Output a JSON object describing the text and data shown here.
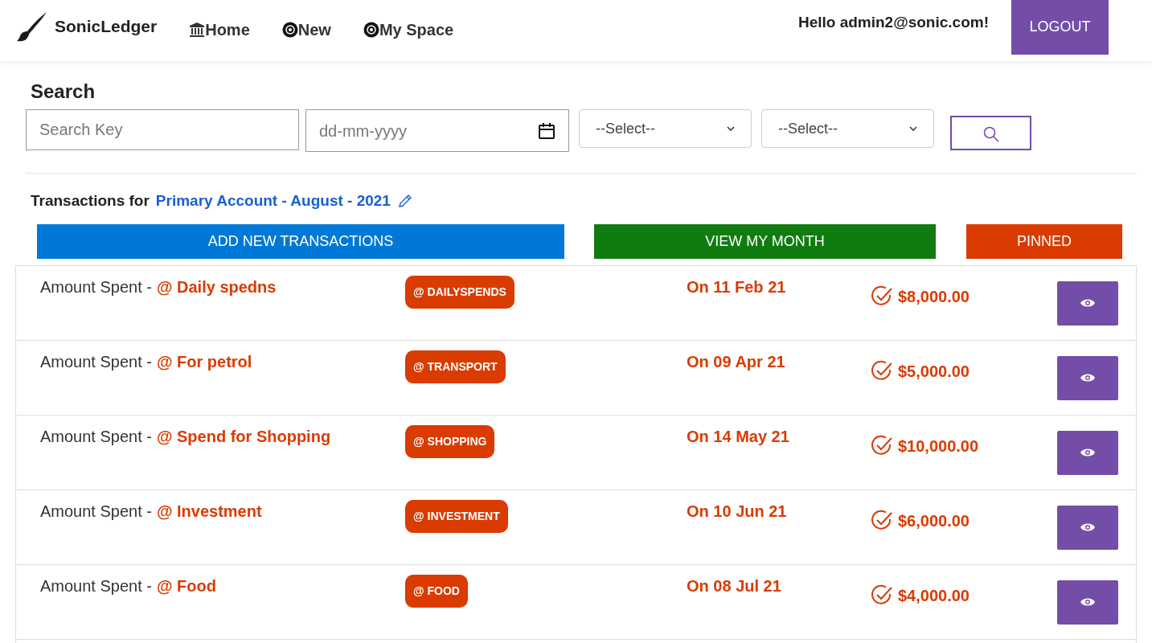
{
  "brand": "SonicLedger",
  "nav": [
    {
      "label": "Home"
    },
    {
      "label": "New"
    },
    {
      "label": "My Space"
    }
  ],
  "greeting": "Hello admin2@sonic.com!",
  "logout": "LOGOUT",
  "search": {
    "title": "Search",
    "key_placeholder": "Search Key",
    "date_placeholder": "dd-mm-yyyy",
    "select_1": "--Select--",
    "select_2": "--Select--"
  },
  "heading": {
    "prefix": "Transactions for",
    "account": "Primary Account - August - 2021"
  },
  "actions": [
    {
      "label": "ADD NEW TRANSACTIONS",
      "color": "#0078d7"
    },
    {
      "label": "VIEW MY MONTH",
      "color": "#107c10"
    },
    {
      "label": "PINNED",
      "color": "#da3b01"
    }
  ],
  "transactions": [
    {
      "label": "Amount Spent -",
      "title": "@ Daily spedns",
      "tag": "@ DAILYSPENDS",
      "date": "On 11 Feb 21",
      "amount": "$8,000.00"
    },
    {
      "label": "Amount Spent -",
      "title": "@ For petrol",
      "tag": "@ TRANSPORT",
      "date": "On 09 Apr 21",
      "amount": "$5,000.00"
    },
    {
      "label": "Amount Spent -",
      "title": "@ Spend for Shopping",
      "tag": "@ SHOPPING",
      "date": "On 14 May 21",
      "amount": "$10,000.00"
    },
    {
      "label": "Amount Spent -",
      "title": "@ Investment",
      "tag": "@ INVESTMENT",
      "date": "On 10 Jun 21",
      "amount": "$6,000.00"
    },
    {
      "label": "Amount Spent -",
      "title": "@ Food",
      "tag": "@ FOOD",
      "date": "On 08 Jul 21",
      "amount": "$4,000.00"
    }
  ]
}
